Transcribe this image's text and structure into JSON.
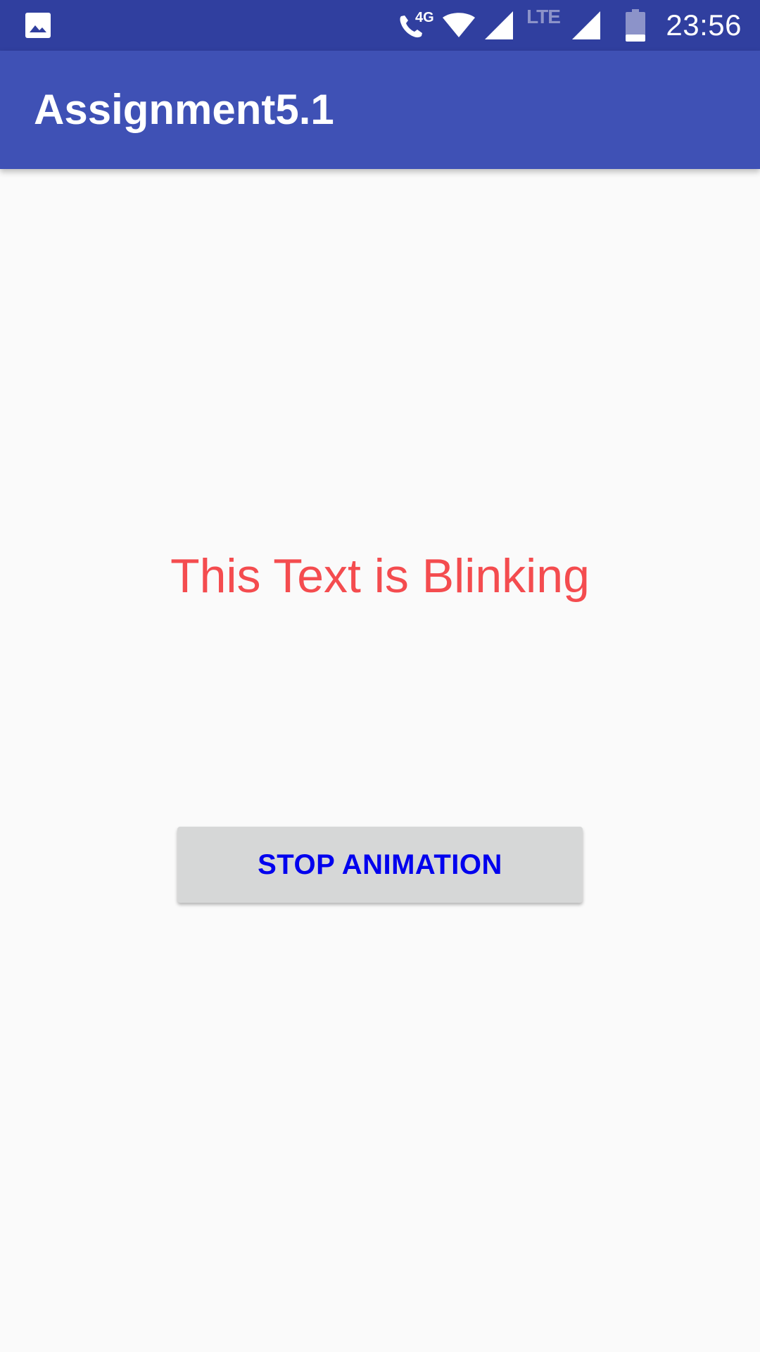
{
  "status_bar": {
    "time": "23:56",
    "call_badge": "4G",
    "network_label": "LTE",
    "icons": [
      "gallery-icon",
      "wifi-call-icon",
      "wifi-icon",
      "signal-icon",
      "signal-icon",
      "battery-icon"
    ],
    "background": "#303f9f"
  },
  "app_bar": {
    "title": "Assignment5.1",
    "background": "#3f51b5"
  },
  "main": {
    "blink_text": "This Text is Blinking",
    "blink_text_color": "#f44c4f",
    "button_label": "STOP ANIMATION",
    "button_text_color": "#0000ee",
    "button_background": "#d6d7d7"
  }
}
